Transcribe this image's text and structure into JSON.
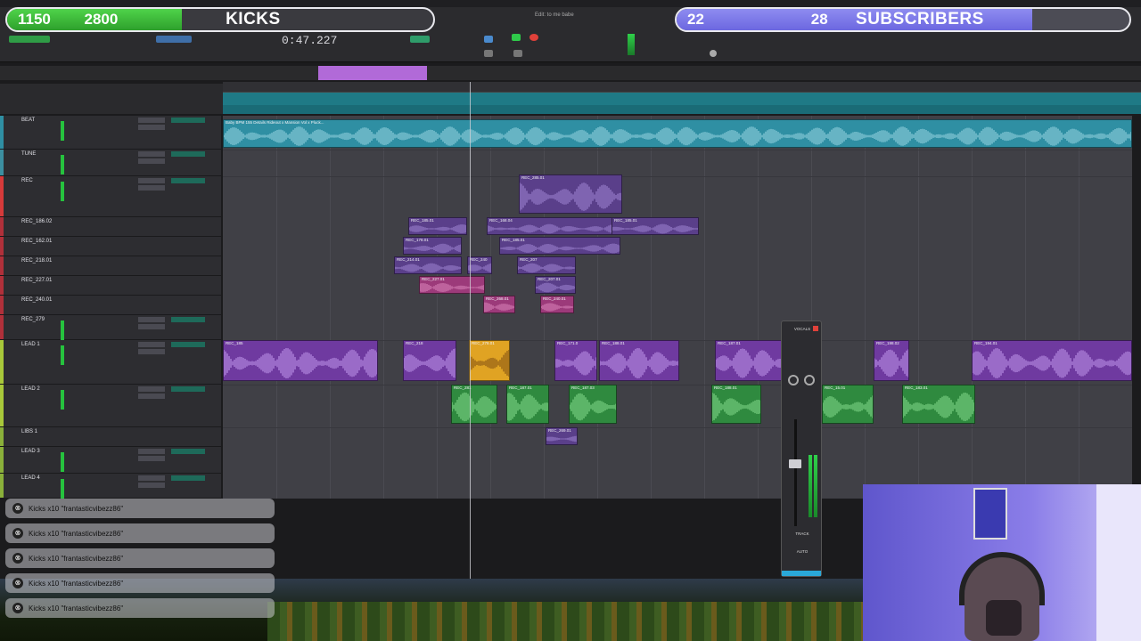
{
  "overlay": {
    "left_counter": {
      "current": "1150",
      "label": "KICKS",
      "goal": "2800",
      "progress": 0.41
    },
    "right_counter": {
      "current": "22",
      "label": "SUBSCRIBERS",
      "goal": "28",
      "progress": 0.786
    }
  },
  "transport": {
    "counter_value": "0:47.227",
    "window_title": "Edit: to me babe"
  },
  "tracks": [
    {
      "name": "BEAT",
      "color": "#2f8fa3"
    },
    {
      "name": "TUNE",
      "color": "#3c8fa0"
    },
    {
      "name": "REC",
      "color": "#d63a3a"
    },
    {
      "name": "REC_186.02",
      "color": "#b0303a"
    },
    {
      "name": "REC_162.01",
      "color": "#b0303a"
    },
    {
      "name": "REC_218.01",
      "color": "#b0303a"
    },
    {
      "name": "REC_227.01",
      "color": "#b0303a"
    },
    {
      "name": "REC_240.01",
      "color": "#b0303a"
    },
    {
      "name": "REC_279",
      "color": "#b0303a"
    },
    {
      "name": "LEAD 1",
      "color": "#a8c83a"
    },
    {
      "name": "LEAD 2",
      "color": "#a8c83a"
    },
    {
      "name": "LIBS 1",
      "color": "#8ab03a"
    },
    {
      "name": "LEAD 3",
      "color": "#8ab03a"
    },
    {
      "name": "LEAD 4",
      "color": "#8ab03a"
    }
  ],
  "clips": {
    "beat": "Baby BPM 155 Details Rideout x Mansion Vol x Pluck...",
    "rec": [
      "REC_285.01",
      "REC_185.01",
      "REC_168.04",
      "REC_185.01",
      "REC_178.01",
      "REC_185.01",
      "REC_214.01",
      "REC_240",
      "REC_207",
      "REC_227.01",
      "REC_207.01",
      "REC_268.01",
      "REC_240.01"
    ],
    "lead1": [
      "REC_185",
      "REC_218",
      "REC_278.01",
      "REC_171.0",
      "REC_1",
      "REC_188.01",
      "REC_187.01",
      "REC_198.02",
      "REC_194.01"
    ],
    "lead2": [
      "REC_281",
      "REC_2934",
      "REC_187.01",
      "REC_187.03",
      "REC_188.01",
      "REC_15.01",
      "REC_183.01"
    ],
    "libs": [
      "REC_269.01"
    ]
  },
  "mixer_strip": {
    "title": "VOCALS",
    "track_label": "TRACK",
    "auto_label": "AUTO"
  },
  "comments": [
    "Kicks x10 \"frantasticvibezz86\"",
    "Kicks x10 \"frantasticvibezz86\"",
    "Kicks x10 \"frantasticvibezz86\"",
    "Kicks x10 \"frantasticvibezz86\"",
    "Kicks x10 \"frantasticvibezz86\""
  ]
}
